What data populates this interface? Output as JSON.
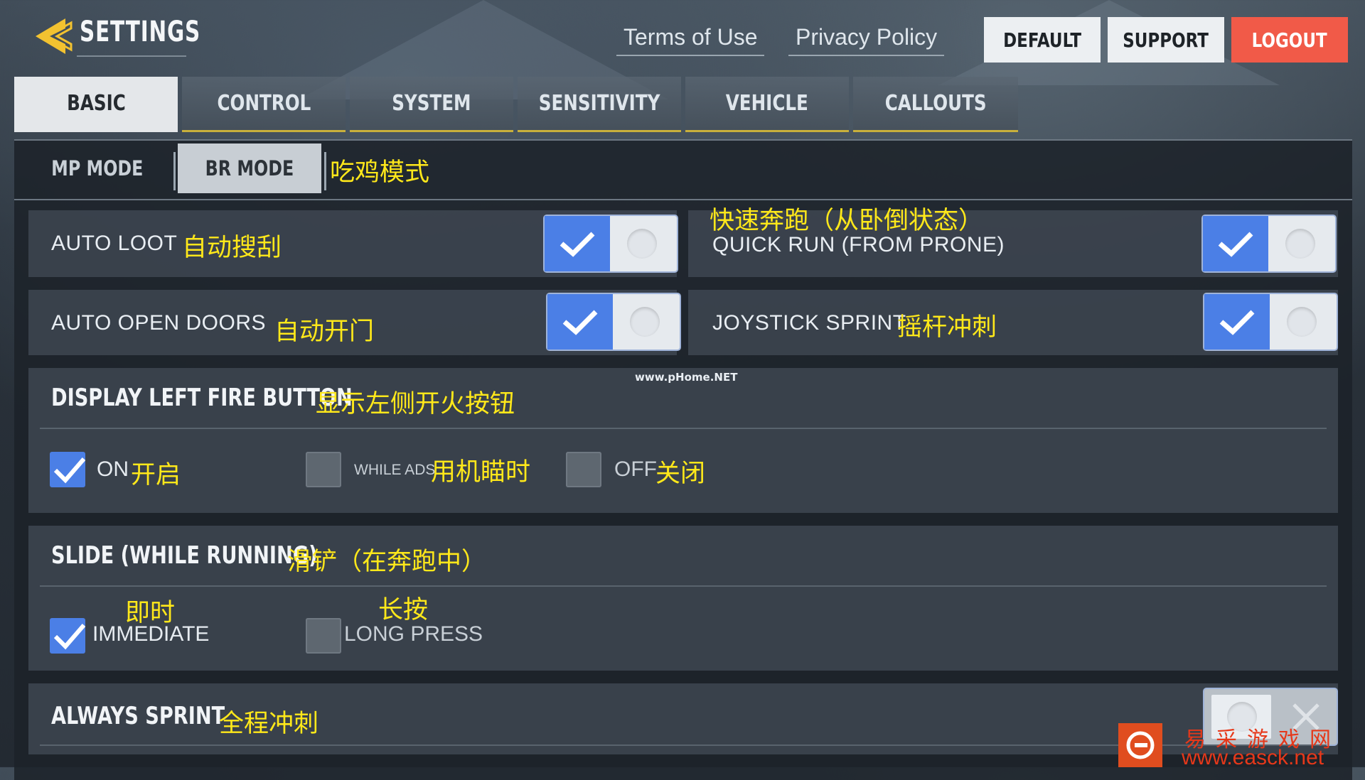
{
  "header": {
    "title": "SETTINGS",
    "links": [
      "Terms of Use",
      "Privacy Policy"
    ],
    "buttons": {
      "default": "DEFAULT",
      "support": "SUPPORT",
      "logout": "LOGOUT"
    }
  },
  "tabs": [
    "BASIC",
    "CONTROL",
    "SYSTEM",
    "SENSITIVITY",
    "VEHICLE",
    "CALLOUTS"
  ],
  "active_tab": "BASIC",
  "subtabs": {
    "mp": "MP MODE",
    "br": "BR MODE",
    "br_cn": "吃鸡模式"
  },
  "settings": {
    "auto_loot": {
      "label": "AUTO LOOT",
      "cn": "自动搜刮",
      "on": true
    },
    "quick_run": {
      "label": "QUICK RUN (FROM PRONE)",
      "cn": "快速奔跑（从卧倒状态）",
      "on": true
    },
    "auto_open_doors": {
      "label": "AUTO OPEN DOORS",
      "cn": "自动开门",
      "on": true
    },
    "joystick_sprint": {
      "label": "JOYSTICK SPRINT",
      "cn": "摇杆冲刺",
      "on": true
    },
    "left_fire": {
      "label": "DISPLAY LEFT FIRE BUTTON",
      "cn": "显示左侧开火按钮",
      "options": [
        {
          "label": "ON",
          "cn": "开启",
          "checked": true
        },
        {
          "label": "WHILE ADS",
          "cn": "用机瞄时",
          "checked": false
        },
        {
          "label": "OFF",
          "cn": "关闭",
          "checked": false
        }
      ]
    },
    "slide": {
      "label": "SLIDE (WHILE RUNNING)",
      "cn": "滑铲（在奔跑中）",
      "options": [
        {
          "label": "IMMEDIATE",
          "cn": "即时",
          "checked": true
        },
        {
          "label": "LONG PRESS",
          "cn": "长按",
          "checked": false
        }
      ]
    },
    "always_sprint": {
      "label": "ALWAYS SPRINT",
      "cn": "全程冲刺",
      "on": false
    }
  },
  "watermark": "www.pHome.NET",
  "site": {
    "name": "易采游戏网",
    "url": "www.easck.net"
  },
  "colors": {
    "accent_blue": "#4b7fe6",
    "logout_red": "#f15a48",
    "annotation_yellow": "#ffe81a",
    "tab_underline": "#c8b03c"
  }
}
